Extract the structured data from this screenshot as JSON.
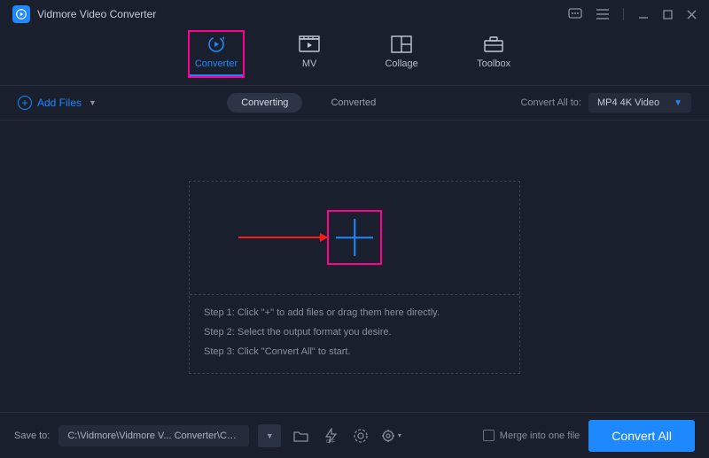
{
  "app": {
    "title": "Vidmore Video Converter"
  },
  "tabs": {
    "converter": "Converter",
    "mv": "MV",
    "collage": "Collage",
    "toolbox": "Toolbox"
  },
  "subbar": {
    "add_files": "Add Files",
    "converting": "Converting",
    "converted": "Converted",
    "convert_all_to_label": "Convert All to:",
    "format": "MP4 4K Video"
  },
  "drop": {
    "step1": "Step 1: Click \"+\" to add files or drag them here directly.",
    "step2": "Step 2: Select the output format you desire.",
    "step3": "Step 3: Click \"Convert All\" to start."
  },
  "footer": {
    "save_to": "Save to:",
    "path": "C:\\Vidmore\\Vidmore V... Converter\\Converted",
    "merge": "Merge into one file",
    "convert_all": "Convert All"
  }
}
